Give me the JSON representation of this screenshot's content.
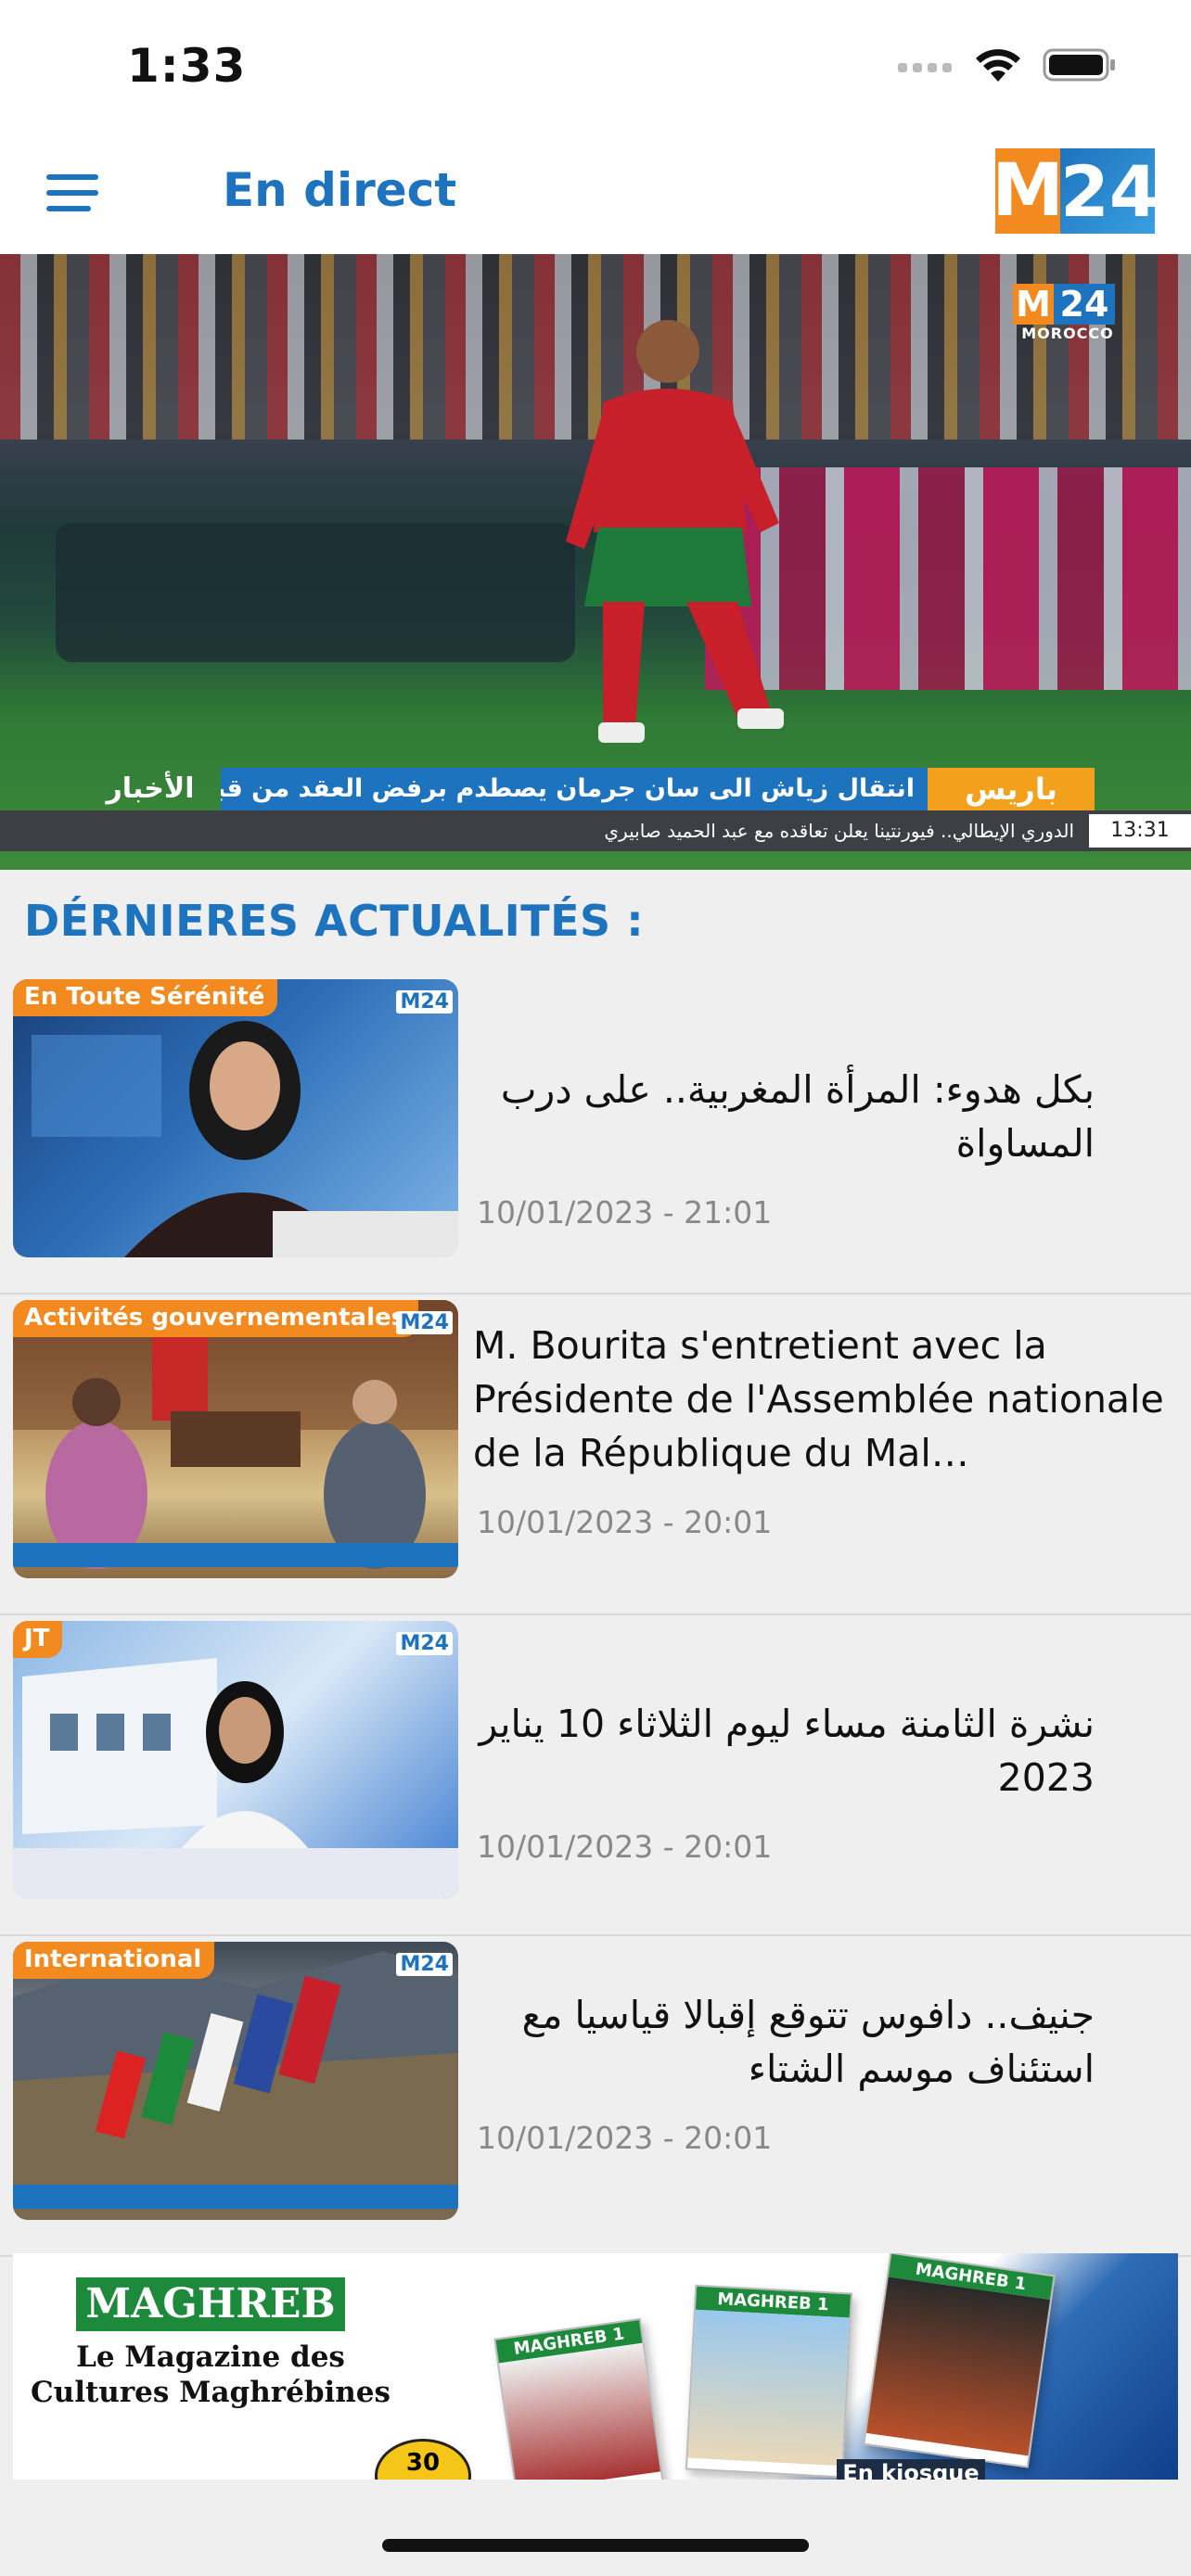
{
  "status_bar": {
    "time": "1:33"
  },
  "nav": {
    "title": "En direct",
    "logo_m": "M",
    "logo_24": "24"
  },
  "hero": {
    "logo_m": "M",
    "logo_24": "24",
    "logo_sub": "MOROCCO",
    "ticker_brand": "الأخبار",
    "ticker_headline": "انتقال زياش الى سان جرمان يصطدم برفض العقد من قبل رابطة المحترفين",
    "ticker_city": "باريس",
    "ticker_sub": "الدوري الإيطالي.. فيورنتينا يعلن تعاقده مع عبد الحميد صابيري",
    "ticker_time": "13:31"
  },
  "section_title": "DÉRNIERES ACTUALITÉS :",
  "news": [
    {
      "tag": "En Toute Sérénité",
      "logo": "M24",
      "title": "بكل هدوء: المرأة المغربية.. على درب المساواة",
      "date": "10/01/2023 - 21:01",
      "rtl": true
    },
    {
      "tag": "Activités gouvernementales",
      "logo": "M24",
      "title": "M. Bourita s'entretient avec la Présidente de l'Assemblée nationale de la République du Mal…",
      "date": "10/01/2023 - 20:01",
      "rtl": false
    },
    {
      "tag": "JT",
      "logo": "M24",
      "title": "نشرة الثامنة مساء ليوم الثلاثاء 10 يناير 2023",
      "date": "10/01/2023 - 20:01",
      "rtl": true
    },
    {
      "tag": "International",
      "logo": "M24",
      "title": "جنيف.. دافوس تتوقع إقبالا قياسيا مع استئناف موسم الشتاء",
      "date": "10/01/2023 - 20:01",
      "rtl": true
    }
  ],
  "ad": {
    "brand": "MAGHREB 1",
    "tagline_1": "Le Magazine des",
    "tagline_2": "Cultures Maghrébines",
    "price": "30",
    "mag_titles": [
      "MAGHREB 1",
      "MAGHREB 1",
      "MAGHREB 1"
    ],
    "kiosque": "En kiosque"
  }
}
